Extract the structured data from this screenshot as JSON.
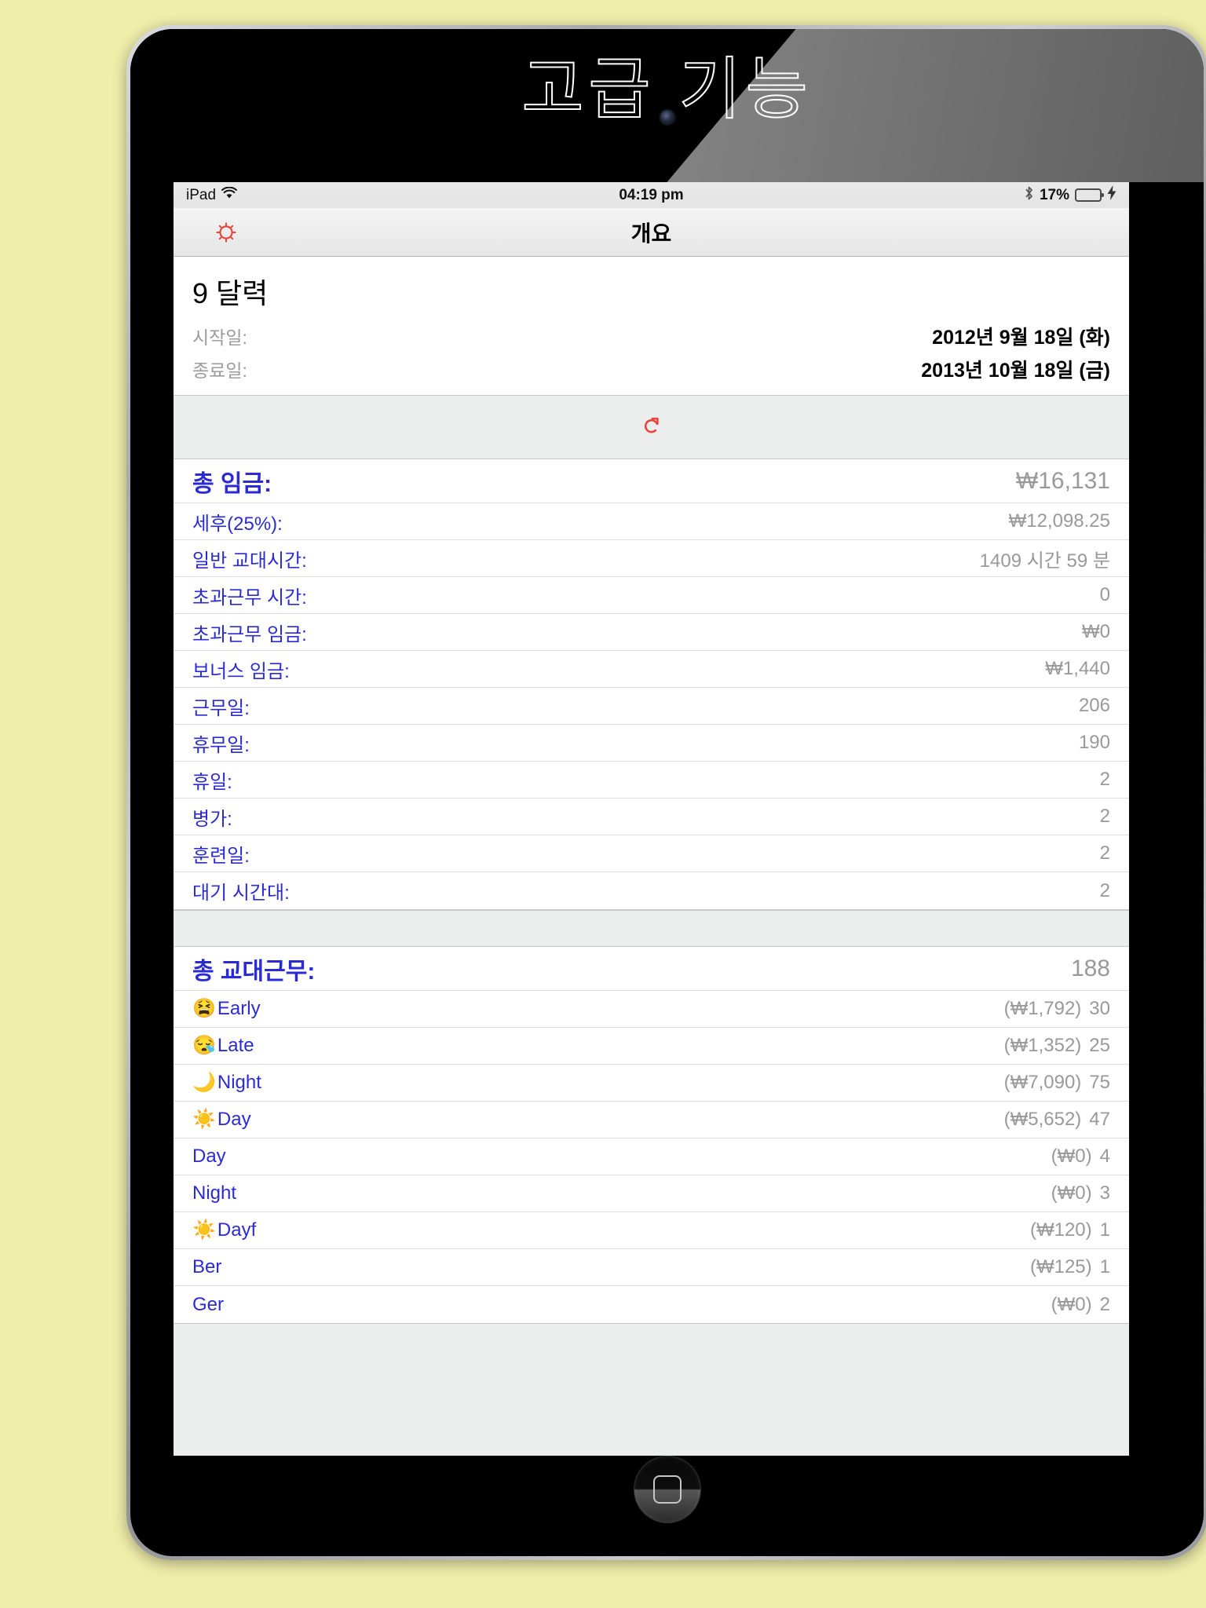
{
  "background_color": "#f0eeab",
  "banner": {
    "title": "고급 기능",
    "camera_icon": "camera-dot"
  },
  "status_bar": {
    "device_label": "iPad",
    "wifi_icon": "wifi-icon",
    "time": "04:19 pm",
    "bluetooth_icon": "bluetooth-icon",
    "battery_percent": "17%",
    "battery_level": 17,
    "battery_color": "#4cd462",
    "charging_icon": "bolt-icon"
  },
  "nav_bar": {
    "settings_icon": "gear-icon",
    "settings_icon_color": "#e8453c",
    "title": "개요"
  },
  "calendar": {
    "name": "9 달력",
    "start_label": "시작일:",
    "start_value": "2012년 9월 18일 (화)",
    "end_label": "종료일:",
    "end_value": "2013년 10월 18일 (금)"
  },
  "refresh": {
    "icon": "refresh-icon",
    "color": "#e8453c"
  },
  "wages": {
    "header": {
      "label": "총 임금:",
      "value": "₩16,131"
    },
    "rows": [
      {
        "label": "세후(25%):",
        "value": "₩12,098.25"
      },
      {
        "label": "일반 교대시간:",
        "value": "1409 시간 59 분"
      },
      {
        "label": "초과근무 시간:",
        "value": "0"
      },
      {
        "label": "초과근무 임금:",
        "value": "₩0"
      },
      {
        "label": "보너스 임금:",
        "value": "₩1,440"
      },
      {
        "label": "근무일:",
        "value": "206"
      },
      {
        "label": "휴무일:",
        "value": "190"
      },
      {
        "label": "휴일:",
        "value": "2"
      },
      {
        "label": "병가:",
        "value": "2"
      },
      {
        "label": "훈련일:",
        "value": "2"
      },
      {
        "label": "대기 시간대:",
        "value": "2"
      }
    ]
  },
  "shifts": {
    "header": {
      "label": "총 교대근무:",
      "value": "188"
    },
    "rows": [
      {
        "emoji": "😫",
        "label": "Early",
        "amount": "(₩1,792)",
        "count": "30"
      },
      {
        "emoji": "😪",
        "label": "Late",
        "amount": "(₩1,352)",
        "count": "25"
      },
      {
        "emoji": "🌙",
        "label": "Night",
        "amount": "(₩7,090)",
        "count": "75"
      },
      {
        "emoji": "☀️",
        "label": "Day",
        "amount": "(₩5,652)",
        "count": "47"
      },
      {
        "emoji": "",
        "label": "Day",
        "amount": "(₩0)",
        "count": "4"
      },
      {
        "emoji": "",
        "label": "Night",
        "amount": "(₩0)",
        "count": "3"
      },
      {
        "emoji": "☀️",
        "label": "Dayf",
        "amount": "(₩120)",
        "count": "1"
      },
      {
        "emoji": "",
        "label": "Ber",
        "amount": "(₩125)",
        "count": "1"
      },
      {
        "emoji": "",
        "label": "Ger",
        "amount": "(₩0)",
        "count": "2"
      }
    ]
  },
  "home_button": {
    "icon": "home-icon"
  }
}
